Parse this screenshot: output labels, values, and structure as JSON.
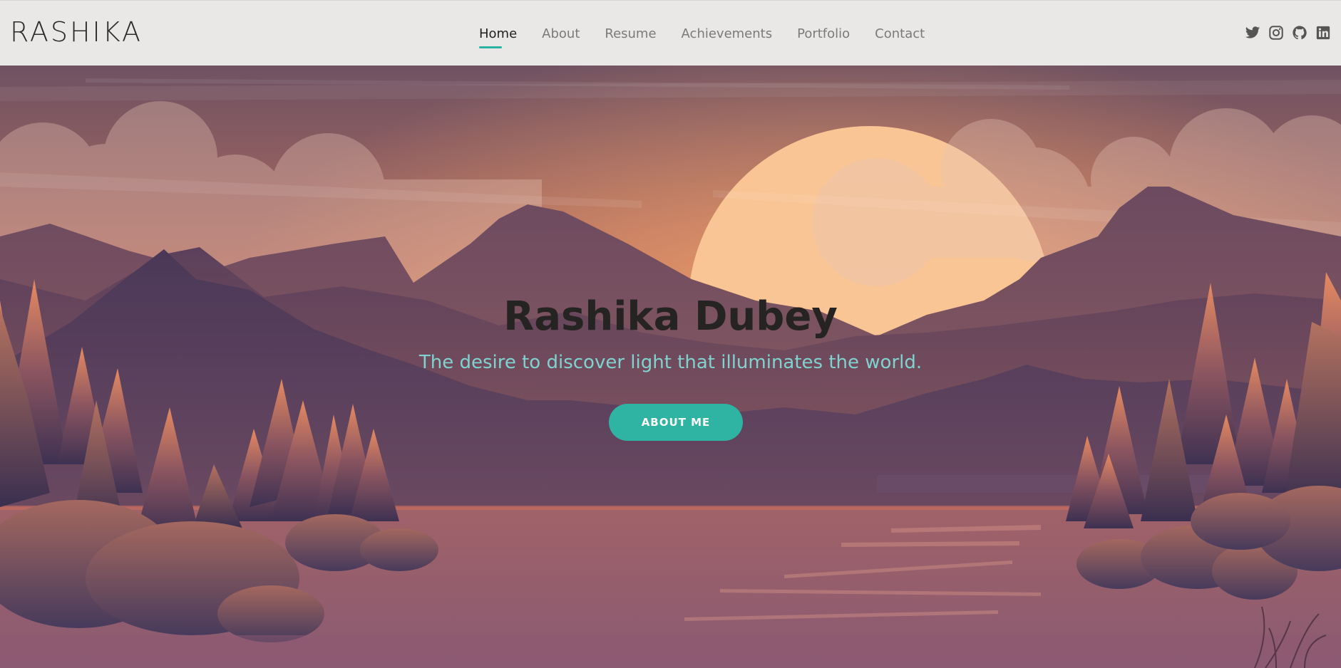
{
  "site": {
    "logo": "RASHIKA"
  },
  "nav": {
    "items": [
      {
        "label": "Home",
        "active": true
      },
      {
        "label": "About"
      },
      {
        "label": "Resume"
      },
      {
        "label": "Achievements"
      },
      {
        "label": "Portfolio"
      },
      {
        "label": "Contact"
      }
    ]
  },
  "socials": [
    "twitter-icon",
    "instagram-icon",
    "github-icon",
    "linkedin-icon"
  ],
  "hero": {
    "name": "Rashika Dubey",
    "tagline": "The desire to discover light that illuminates the world.",
    "button_label": "ABOUT ME"
  },
  "colors": {
    "accent": "#2fb3a3",
    "tagline": "#7fd2cf"
  }
}
